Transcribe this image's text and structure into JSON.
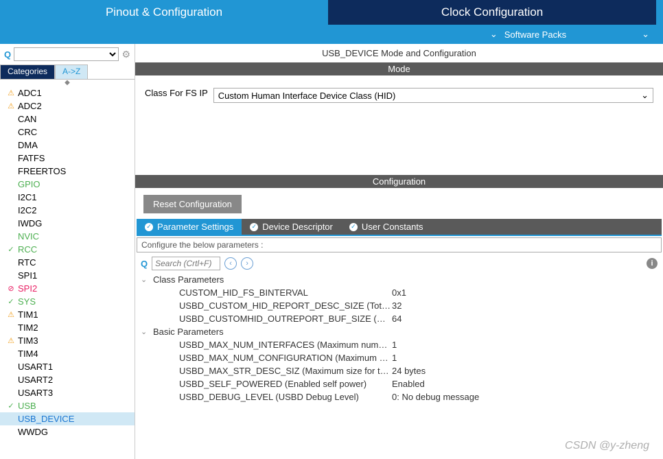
{
  "topTabs": {
    "pinout": "Pinout & Configuration",
    "clock": "Clock Configuration"
  },
  "subBar": {
    "softwarePacks": "Software Packs"
  },
  "sidebar": {
    "tabs": {
      "categories": "Categories",
      "az": "A->Z"
    },
    "items": [
      {
        "icon": "warn",
        "label": "ADC1"
      },
      {
        "icon": "warn",
        "label": "ADC2"
      },
      {
        "icon": "",
        "label": "CAN"
      },
      {
        "icon": "",
        "label": "CRC"
      },
      {
        "icon": "",
        "label": "DMA"
      },
      {
        "icon": "",
        "label": "FATFS"
      },
      {
        "icon": "",
        "label": "FREERTOS"
      },
      {
        "icon": "",
        "label": "GPIO",
        "class": "green-text"
      },
      {
        "icon": "",
        "label": "I2C1"
      },
      {
        "icon": "",
        "label": "I2C2"
      },
      {
        "icon": "",
        "label": "IWDG"
      },
      {
        "icon": "",
        "label": "NVIC",
        "class": "green-text"
      },
      {
        "icon": "ok",
        "label": "RCC",
        "class": "green-text"
      },
      {
        "icon": "",
        "label": "RTC"
      },
      {
        "icon": "",
        "label": "SPI1"
      },
      {
        "icon": "err",
        "label": "SPI2",
        "class": "pink-text"
      },
      {
        "icon": "ok",
        "label": "SYS",
        "class": "green-text"
      },
      {
        "icon": "warn",
        "label": "TIM1"
      },
      {
        "icon": "",
        "label": "TIM2"
      },
      {
        "icon": "warn",
        "label": "TIM3"
      },
      {
        "icon": "",
        "label": "TIM4"
      },
      {
        "icon": "",
        "label": "USART1"
      },
      {
        "icon": "",
        "label": "USART2"
      },
      {
        "icon": "",
        "label": "USART3"
      },
      {
        "icon": "ok",
        "label": "USB",
        "class": "green-text"
      },
      {
        "icon": "",
        "label": "USB_DEVICE",
        "class": "blue-text",
        "selected": true
      },
      {
        "icon": "",
        "label": "WWDG"
      }
    ]
  },
  "content": {
    "title": "USB_DEVICE Mode and Configuration",
    "modeHeader": "Mode",
    "modeLabel": "Class For FS IP",
    "modeValue": "Custom Human Interface Device Class (HID)",
    "configHeader": "Configuration",
    "resetBtn": "Reset Configuration",
    "innerTabs": {
      "param": "Parameter Settings",
      "device": "Device Descriptor",
      "user": "User Constants"
    },
    "configDesc": "Configure the below parameters :",
    "searchPlaceholder": "Search (Crtl+F)",
    "groups": [
      {
        "name": "Class Parameters",
        "rows": [
          {
            "name": "CUSTOM_HID_FS_BINTERVAL",
            "value": "0x1"
          },
          {
            "name": "USBD_CUSTOM_HID_REPORT_DESC_SIZE (Total…",
            "value": "32"
          },
          {
            "name": "USBD_CUSTOMHID_OUTREPORT_BUF_SIZE (Ma…",
            "value": "64"
          }
        ]
      },
      {
        "name": "Basic Parameters",
        "rows": [
          {
            "name": "USBD_MAX_NUM_INTERFACES (Maximum numb…",
            "value": "1"
          },
          {
            "name": "USBD_MAX_NUM_CONFIGURATION (Maximum n…",
            "value": "1"
          },
          {
            "name": "USBD_MAX_STR_DESC_SIZ (Maximum size for th…",
            "value": "24 bytes"
          },
          {
            "name": "USBD_SELF_POWERED (Enabled self power)",
            "value": "Enabled"
          },
          {
            "name": "USBD_DEBUG_LEVEL (USBD Debug Level)",
            "value": "0: No debug message"
          }
        ]
      }
    ]
  },
  "watermark": "CSDN @y-zheng"
}
